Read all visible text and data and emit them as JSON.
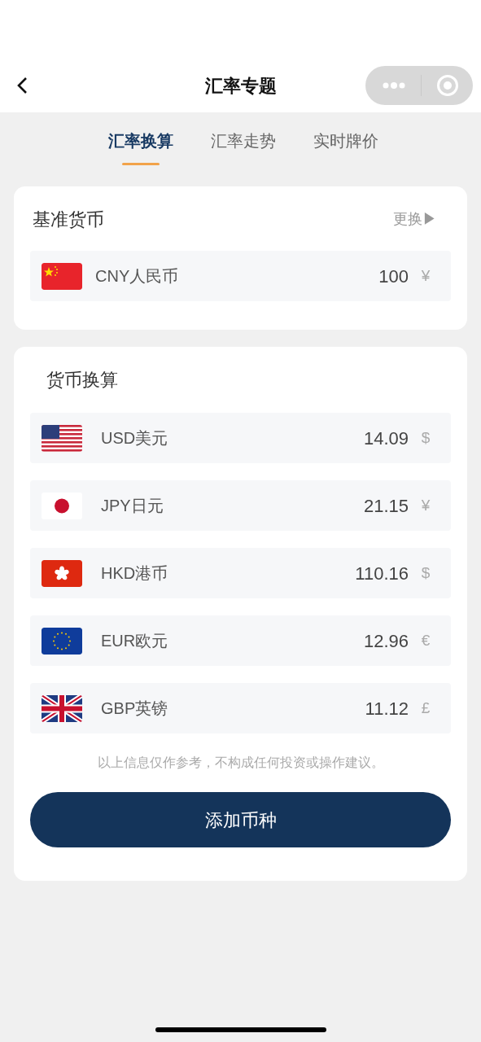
{
  "nav": {
    "title": "汇率专题"
  },
  "tabs": [
    {
      "label": "汇率换算",
      "selected": true
    },
    {
      "label": "汇率走势",
      "selected": false
    },
    {
      "label": "实时牌价",
      "selected": false
    }
  ],
  "base": {
    "title": "基准货币",
    "change": "更换▶",
    "row": {
      "kind": "cn",
      "name": "CNY人民币",
      "amount": "100",
      "symbol": "¥"
    }
  },
  "convert": {
    "title": "货币换算",
    "rows": [
      {
        "kind": "us",
        "name": "USD美元",
        "amount": "14.09",
        "symbol": "$"
      },
      {
        "kind": "jp",
        "name": "JPY日元",
        "amount": "21.15",
        "symbol": "¥"
      },
      {
        "kind": "hk",
        "name": "HKD港币",
        "amount": "110.16",
        "symbol": "$"
      },
      {
        "kind": "eu",
        "name": "EUR欧元",
        "amount": "12.96",
        "symbol": "€"
      },
      {
        "kind": "gb",
        "name": "GBP英镑",
        "amount": "11.12",
        "symbol": "£"
      }
    ],
    "disclaimer": "以上信息仅作参考，不构成任何投资或操作建议。",
    "button": "添加币种"
  }
}
